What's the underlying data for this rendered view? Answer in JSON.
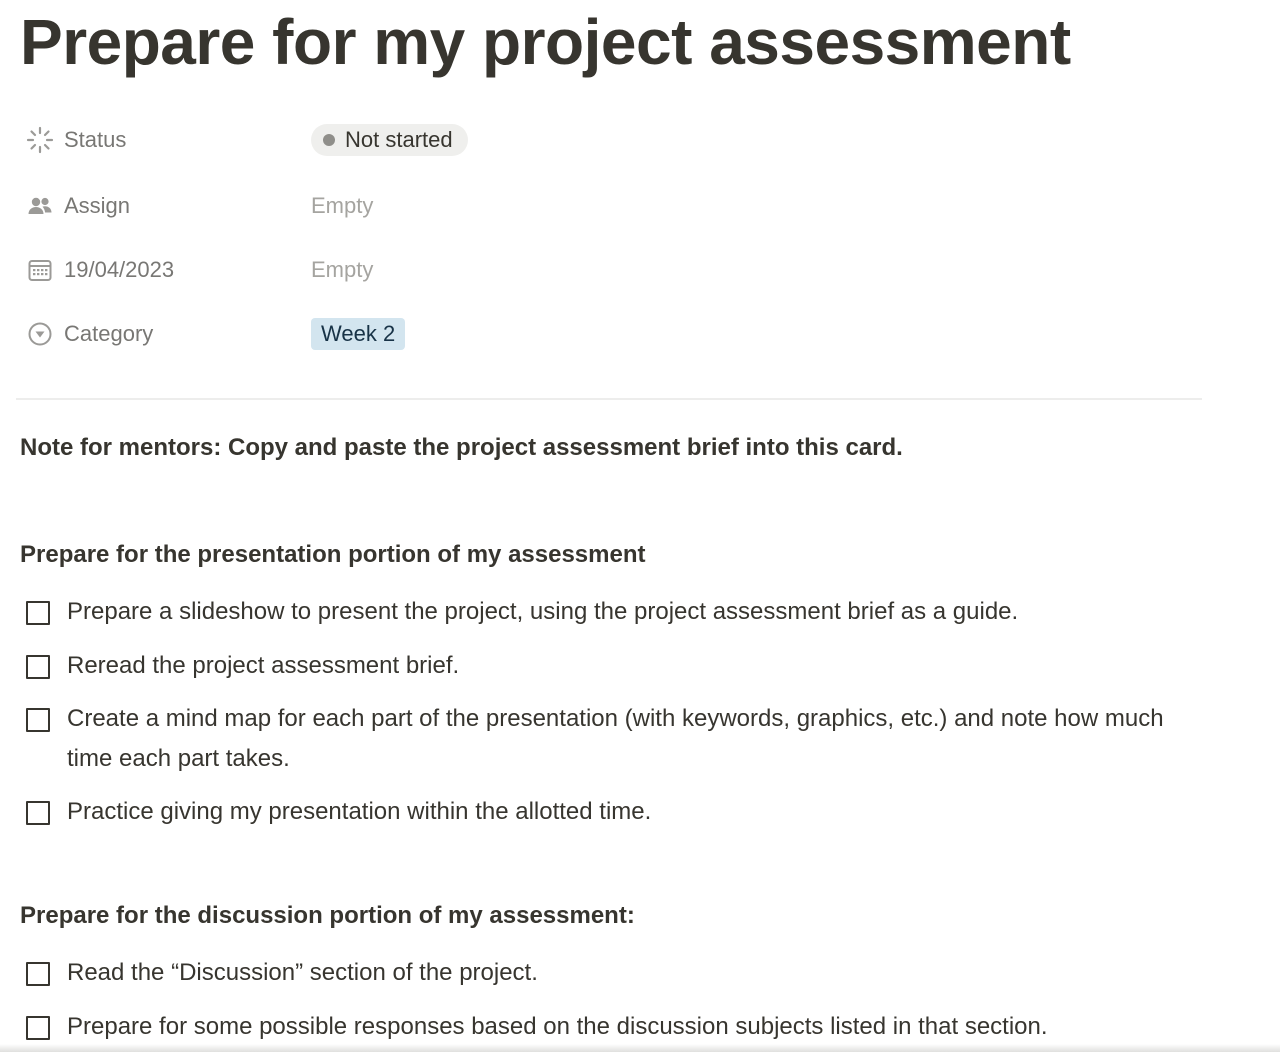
{
  "page": {
    "title": "Prepare for my project assessment"
  },
  "properties": [
    {
      "label": "Status",
      "icon": "status-spinner-icon",
      "value": "Not started",
      "type": "status"
    },
    {
      "label": "Assign",
      "icon": "people-icon",
      "value": "Empty",
      "type": "empty"
    },
    {
      "label": "19/04/2023",
      "icon": "calendar-icon",
      "value": "Empty",
      "type": "empty"
    },
    {
      "label": "Category",
      "icon": "select-arrow-icon",
      "value": "Week 2",
      "type": "tag"
    }
  ],
  "colors": {
    "text": "#37352f",
    "muted": "#787774",
    "empty": "#a5a4a0",
    "status_bg": "#efefed",
    "status_dot": "#8f8e8a",
    "tag_bg": "#d3e5ef",
    "tag_text": "#183347"
  },
  "note": "Note for mentors: Copy and paste the project assessment brief into this card.",
  "sections": [
    {
      "heading": "Prepare for the presentation portion of my assessment",
      "todos": [
        {
          "text": "Prepare a slideshow to present the project, using the project assessment brief as a guide.",
          "checked": false
        },
        {
          "text": "Reread the project assessment brief.",
          "checked": false
        },
        {
          "text": "Create a mind map for each part of the presentation (with keywords, graphics, etc.) and note how much time each part takes.",
          "checked": false
        },
        {
          "text": "Practice giving my presentation within the allotted time.",
          "checked": false
        }
      ]
    },
    {
      "heading": "Prepare for the discussion portion of my assessment:",
      "todos": [
        {
          "text": "Read the “Discussion” section of the project.",
          "checked": false
        },
        {
          "text": "Prepare for some possible responses based on the discussion subjects listed in that section.",
          "checked": false
        }
      ]
    }
  ]
}
